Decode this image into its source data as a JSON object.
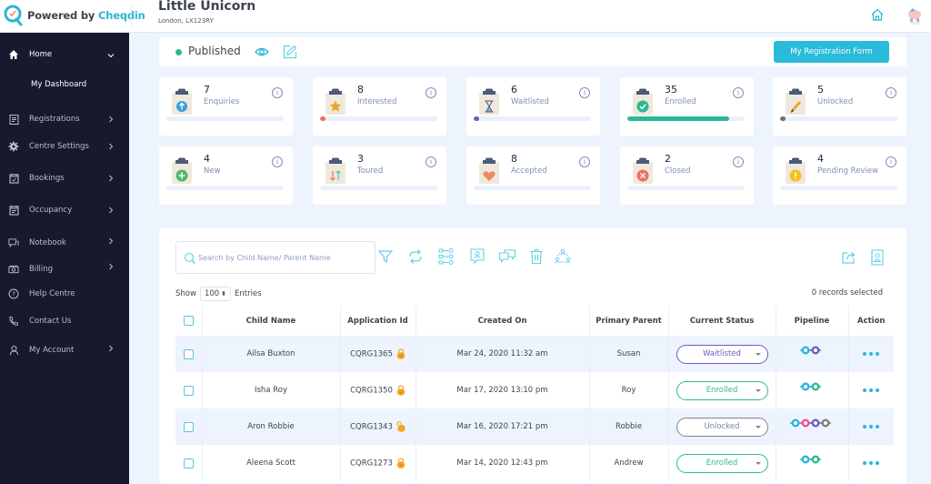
{
  "header": {
    "logo_prefix": "Powered by ",
    "logo_brand": "Cheqdin",
    "centre_name": "Little Unicorn",
    "centre_address": "London, LX123RY",
    "home_icon": "home-icon",
    "avatar_icon": "unicorn-avatar"
  },
  "sidebar": {
    "items": [
      {
        "label": "Home",
        "icon": "home-icon",
        "expanded": true
      },
      {
        "label": "Registrations",
        "icon": "clipboard-icon"
      },
      {
        "label": "Centre Settings",
        "icon": "gear-icon"
      },
      {
        "label": "Bookings",
        "icon": "calendar-check-icon"
      },
      {
        "label": "Occupancy",
        "icon": "calendar-icon"
      },
      {
        "label": "Notebook",
        "icon": "chat-icon"
      },
      {
        "label": "Billing",
        "icon": "money-icon"
      },
      {
        "label": "Help Centre",
        "icon": "help-icon"
      },
      {
        "label": "Contact Us",
        "icon": "phone-icon"
      },
      {
        "label": "My Account",
        "icon": "user-icon"
      }
    ],
    "sub_items": [
      {
        "label": "My Dashboard"
      }
    ]
  },
  "publish_bar": {
    "status": "Published",
    "status_color": "#2bb895",
    "button_label": "My Registration Form"
  },
  "stats": [
    {
      "count": "7",
      "label": "Enquiries",
      "icon": "arrow-up-circle",
      "icon_color": "#3aa0e0",
      "fill_pct": 0,
      "fill_color": "#3aa0e0"
    },
    {
      "count": "8",
      "label": "Interested",
      "icon": "star",
      "icon_color": "#f0a229",
      "fill_pct": 4,
      "fill_color": "#f3704e"
    },
    {
      "count": "6",
      "label": "Waitlisted",
      "icon": "hourglass",
      "icon_color": "#7ea3d8",
      "fill_pct": 4,
      "fill_color": "#6b5bc6"
    },
    {
      "count": "35",
      "label": "Enrolled",
      "icon": "check-circle",
      "icon_color": "#2bb895",
      "fill_pct": 87,
      "fill_color": "#2bb895"
    },
    {
      "count": "5",
      "label": "Unlocked",
      "icon": "pencil",
      "icon_color": "#f0a229",
      "fill_pct": 4,
      "fill_color": "#6f6f6f"
    },
    {
      "count": "4",
      "label": "New",
      "icon": "plus-circle",
      "icon_color": "#4cb86a",
      "fill_pct": 0,
      "fill_color": "#4cb86a"
    },
    {
      "count": "3",
      "label": "Toured",
      "icon": "arrows-up-down",
      "icon_color": "#f3704e",
      "fill_pct": 0,
      "fill_color": "#f3704e"
    },
    {
      "count": "8",
      "label": "Accepted",
      "icon": "heart",
      "icon_color": "#f08a5d",
      "fill_pct": 0,
      "fill_color": "#f08a5d"
    },
    {
      "count": "2",
      "label": "Closed",
      "icon": "x-circle",
      "icon_color": "#f0705d",
      "fill_pct": 0,
      "fill_color": "#f0705d"
    },
    {
      "count": "4",
      "label": "Pending Review",
      "icon": "exclamation-circle",
      "icon_color": "#f5c21b",
      "fill_pct": 0,
      "fill_color": "#f5c21b"
    }
  ],
  "table": {
    "search_placeholder": "Search by Child Name/ Parent Name",
    "show_label": "Show",
    "entries_value": "100",
    "entries_label": "Entries",
    "records_selected": "0 records selected",
    "toolbar_icons": [
      "filter-icon",
      "sync-icon",
      "workflow-icon",
      "contact-chat-icon",
      "messages-icon",
      "trash-icon",
      "group-icon"
    ],
    "right_icons": [
      "export-icon",
      "contact-book-icon"
    ],
    "columns": [
      "Child Name",
      "Application Id",
      "Created On",
      "Primary Parent",
      "Current Status",
      "Pipeline",
      "Action"
    ],
    "rows": [
      {
        "child": "Ailsa Buxton",
        "app_id": "CQRG1365",
        "locked": true,
        "created": "Mar 24, 2020 11:32 am",
        "parent": "Susan",
        "status": "Waitlisted",
        "status_color": "#6b5bc6",
        "pipeline": [
          "#29b6d8",
          "#6b5bc6"
        ]
      },
      {
        "child": "Isha Roy",
        "app_id": "CQRG1350",
        "locked": true,
        "created": "Mar 17, 2020 13:10 pm",
        "parent": "Roy",
        "status": "Enrolled",
        "status_color": "#2bb895",
        "pipeline": [
          "#29b6d8",
          "#2bb895"
        ]
      },
      {
        "child": "Aron Robbie",
        "app_id": "CQRG1343",
        "locked": false,
        "created": "Mar 16, 2020 17:21 pm",
        "parent": "Robbie",
        "status": "Unlocked",
        "status_color": "#7d8594",
        "pipeline": [
          "#29b6d8",
          "#e9508f",
          "#6b5bc6",
          "#7d7d7d"
        ]
      },
      {
        "child": "Aleena Scott",
        "app_id": "CQRG1273",
        "locked": true,
        "created": "Mar 14, 2020 12:43 pm",
        "parent": "Andrew",
        "status": "Enrolled",
        "status_color": "#2bb895",
        "pipeline": [
          "#29b6d8",
          "#2bb895"
        ]
      }
    ]
  }
}
